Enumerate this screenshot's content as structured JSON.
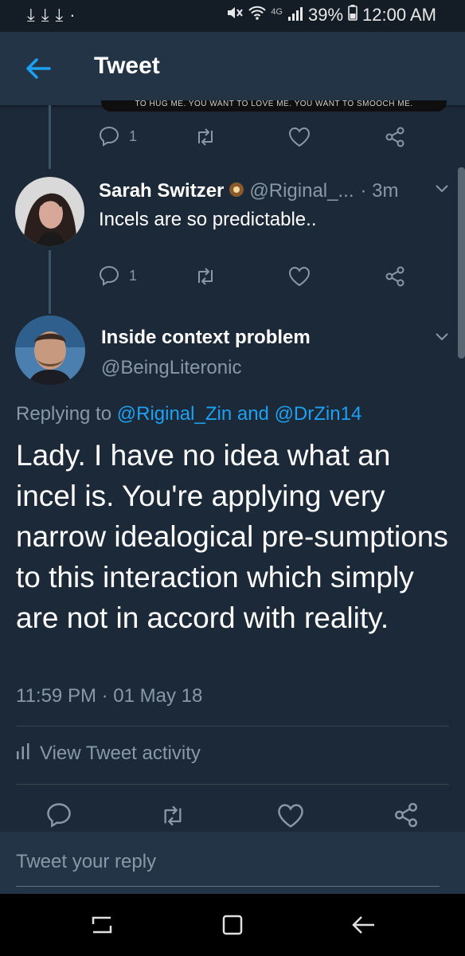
{
  "status_bar": {
    "left_icons": [
      "download-icon",
      "download-icon",
      "download-icon",
      "dot-icon"
    ],
    "network": "4G",
    "battery": "39%",
    "time": "12:00 AM"
  },
  "app_bar": {
    "title": "Tweet"
  },
  "previous_tweet": {
    "media_caption": "TO HUG ME. YOU WANT TO LOVE ME. YOU WANT TO SMOOCH ME.",
    "reply_count": "1"
  },
  "reply_tweet": {
    "name": "Sarah Switzer",
    "handle": "@Riginal_...",
    "time": "· 3m",
    "text": "Incels are so predictable..",
    "reply_count": "1"
  },
  "main_tweet": {
    "name": "Inside context problem",
    "handle": "@BeingLiteronic",
    "replying_prefix": "Replying to",
    "replying_user1": "@Riginal_Zin",
    "replying_and": "and",
    "replying_user2": "@DrZin14",
    "text": "Lady. I have no idea what an incel is. You're applying very narrow idealogical pre-sumptions to this interaction which simply are not in accord with reality.",
    "timestamp": "11:59 PM · 01 May 18",
    "activity_label": "View Tweet activity"
  },
  "reply_box": {
    "placeholder": "Tweet your reply"
  },
  "colors": {
    "background": "#1c2938",
    "app_bar": "#243447",
    "accent": "#1da1f2",
    "secondary_text": "#8899a6"
  }
}
